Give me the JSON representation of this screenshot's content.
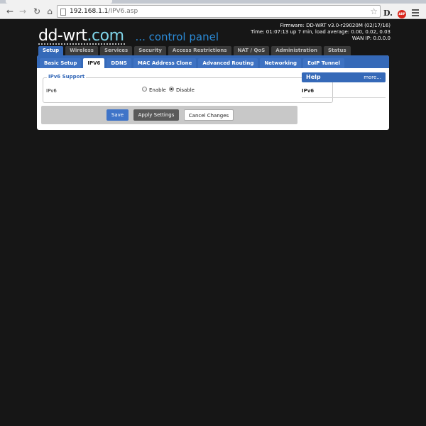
{
  "browser": {
    "url_host": "192.168.1.1",
    "url_path": "/IPV6.asp",
    "ext_label": "D.",
    "abp_label": "ABP"
  },
  "header": {
    "brand_main": "dd-wrt",
    "brand_dot": ".com",
    "brand_sub": "... control panel",
    "firmware": "Firmware: DD-WRT v3.0-r29020M (02/17/16)",
    "time": "Time: 01:07:13 up 7 min, load average: 0.00, 0.02, 0.03",
    "wan_ip": "WAN IP: 0.0.0.0"
  },
  "main_tabs": [
    {
      "label": "Setup",
      "active": true
    },
    {
      "label": "Wireless"
    },
    {
      "label": "Services"
    },
    {
      "label": "Security"
    },
    {
      "label": "Access Restrictions"
    },
    {
      "label": "NAT / QoS"
    },
    {
      "label": "Administration"
    },
    {
      "label": "Status"
    }
  ],
  "sub_tabs": [
    {
      "label": "Basic Setup"
    },
    {
      "label": "IPV6",
      "active": true
    },
    {
      "label": "DDNS"
    },
    {
      "label": "MAC Address Clone"
    },
    {
      "label": "Advanced Routing"
    },
    {
      "label": "Networking"
    },
    {
      "label": "EoIP Tunnel"
    }
  ],
  "ipv6_support": {
    "legend": "IPv6 Support",
    "field_label": "IPv6",
    "option_enable": "Enable",
    "option_disable": "Disable",
    "selected": "Disable"
  },
  "buttons": {
    "save": "Save",
    "apply": "Apply Settings",
    "cancel": "Cancel Changes"
  },
  "help": {
    "title": "Help",
    "more": "more...",
    "topic": "IPv6"
  }
}
